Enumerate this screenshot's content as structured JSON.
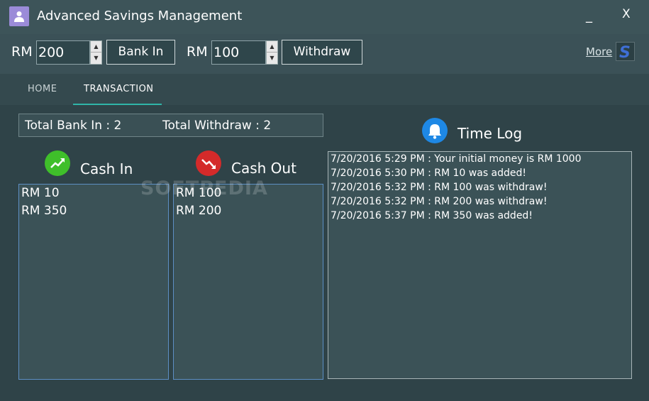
{
  "window": {
    "title": "Advanced Savings Management",
    "minimize_label": "_",
    "close_label": "X"
  },
  "toolbar": {
    "bank_in": {
      "currency": "RM",
      "value": "200",
      "button_label": "Bank In"
    },
    "withdraw": {
      "currency": "RM",
      "value": "100",
      "button_label": "Withdraw"
    },
    "more_label": "More",
    "logo_letter": "S"
  },
  "tabs": [
    {
      "label": "HOME",
      "active": false
    },
    {
      "label": "TRANSACTION",
      "active": true
    }
  ],
  "totals": {
    "bank_in": "Total Bank In : 2",
    "withdraw": "Total Withdraw : 2"
  },
  "cash_in": {
    "title": "Cash In",
    "items": [
      "RM 10",
      "RM 350"
    ]
  },
  "cash_out": {
    "title": "Cash Out",
    "items": [
      "RM 100",
      "RM 200"
    ]
  },
  "time_log": {
    "title": "Time Log",
    "entries": [
      "7/20/2016 5:29 PM : Your initial money is RM 1000",
      "7/20/2016 5:30 PM : RM 10 was added!",
      "7/20/2016 5:32 PM : RM 100 was withdraw!",
      "7/20/2016 5:32 PM : RM 200 was withdraw!",
      "7/20/2016 5:37 PM : RM 350 was added!"
    ]
  },
  "watermark": "SOFTPEDIA",
  "colors": {
    "accent_tab": "#2fb5a8",
    "cash_in_icon": "#3fbf2a",
    "cash_out_icon": "#d42a2a",
    "time_log_icon": "#1e88e5",
    "list_border": "#5d8fc4"
  }
}
